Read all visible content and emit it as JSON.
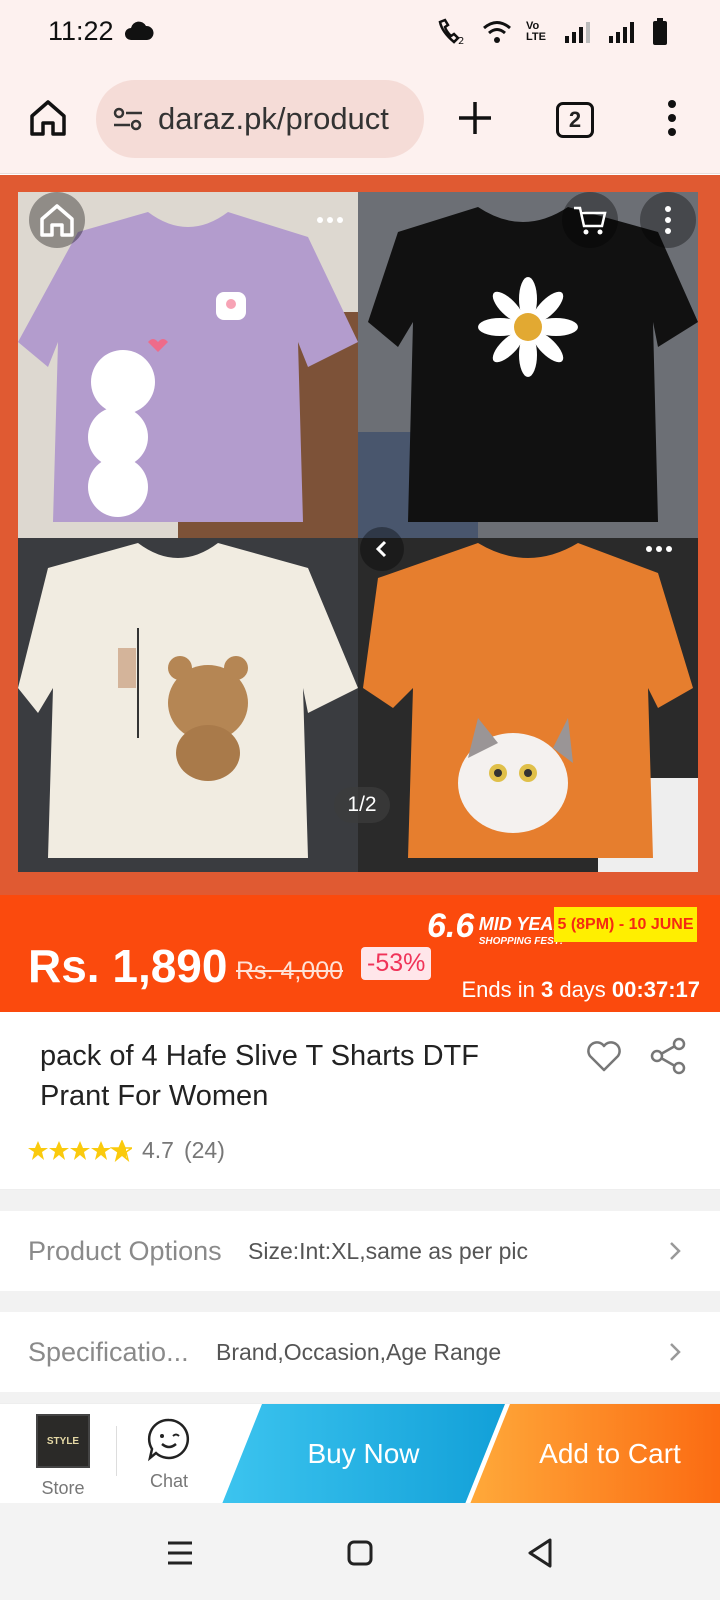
{
  "status_bar": {
    "time": "11:22",
    "volte_label": "Vo LTE"
  },
  "browser": {
    "url": "daraz.pk/product",
    "tab_count": "2"
  },
  "gallery": {
    "counter": "1/2"
  },
  "price_banner": {
    "price": "Rs. 1,890",
    "old_price": "Rs. 4,000",
    "discount": "-53%",
    "promo_number": "6.6",
    "promo_line1": "MID YEAR",
    "promo_line2": "SHOPPING FEST!",
    "promo_date": "5 (8PM) - 10 JUNE",
    "ends_prefix": "Ends in ",
    "ends_days": "3",
    "ends_mid": " days ",
    "ends_time": "00:37:17"
  },
  "product": {
    "title": "pack of 4 Hafe Slive T Sharts DTF Prant For Women",
    "rating": "4.7",
    "rating_count": "(24)",
    "rating_stars": 4.7
  },
  "options": [
    {
      "label": "Product Options",
      "value": "Size:Int:XL,same as per pic"
    },
    {
      "label": "Specificatio...",
      "value": "Brand,Occasion,Age Range"
    }
  ],
  "bottom_bar": {
    "store_label": "Store",
    "store_logo_text": "STYLE",
    "chat_label": "Chat",
    "buy_now": "Buy Now",
    "add_to_cart": "Add to Cart"
  },
  "colors": {
    "brand_orange": "#fb4a0d",
    "buy_now_blue": "#12a0d8",
    "add_cart_orange": "#fb6b12",
    "promo_yellow": "#ffef00",
    "star_yellow": "#faca0d"
  }
}
